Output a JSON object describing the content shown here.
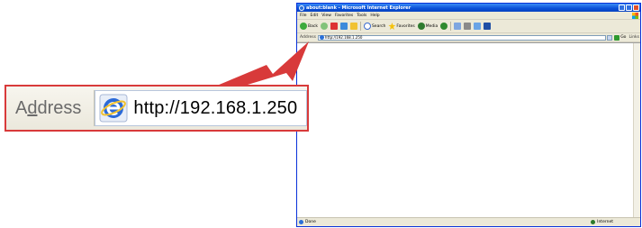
{
  "ie_window": {
    "title": "about:blank - Microsoft Internet Explorer",
    "menu": [
      "File",
      "Edit",
      "View",
      "Favorites",
      "Tools",
      "Help"
    ],
    "toolbar": {
      "back": "Back",
      "search": "Search",
      "favorites": "Favorites",
      "media": "Media"
    },
    "address_label": "Address",
    "address_value": "http://192.168.1.250",
    "go_label": "Go",
    "links_label": "Links",
    "status_text": "Done",
    "zone_text": "Internet"
  },
  "callout": {
    "label": "Address",
    "url": "http://192.168.1.250"
  },
  "colors": {
    "highlight": "#d83a3a",
    "xp_blue": "#0a4fd8"
  }
}
